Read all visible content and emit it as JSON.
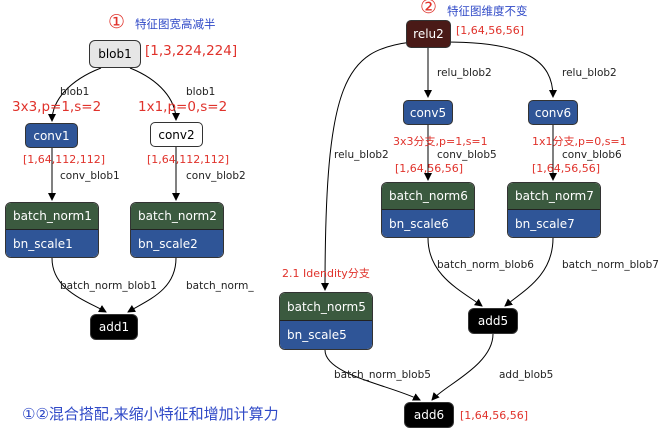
{
  "annotations": {
    "left_marker": "①",
    "left_title": "特征图宽高减半",
    "right_marker": "②",
    "right_title": "特征图维度不变",
    "identity_branch": "2.1 Idendity分支",
    "caption": "①②混合搭配,来缩小特征和增加计算力"
  },
  "nodes": {
    "blob1": "blob1",
    "conv1": "conv1",
    "conv2": "conv2",
    "batch_norm1": "batch_norm1",
    "bn_scale1": "bn_scale1",
    "batch_norm2": "batch_norm2",
    "bn_scale2": "bn_scale2",
    "add1": "add1",
    "relu2": "relu2",
    "conv5": "conv5",
    "conv6": "conv6",
    "batch_norm6": "batch_norm6",
    "bn_scale6": "bn_scale6",
    "batch_norm7": "batch_norm7",
    "bn_scale7": "bn_scale7",
    "batch_norm5": "batch_norm5",
    "bn_scale5": "bn_scale5",
    "add5": "add5",
    "add6": "add6"
  },
  "shapes": {
    "blob1": "[1,3,224,224]",
    "conv1": "[1,64,112,112]",
    "conv2": "[1,64,112,112]",
    "relu2": "[1,64,56,56]",
    "conv5": "[1,64,56,56]",
    "conv6": "[1,64,56,56]",
    "add6": "[1,64,56,56]"
  },
  "params": {
    "conv1": "3x3,p=1,s=2",
    "conv2": "1x1,p=0,s=2",
    "conv5": "3x3分支,p=1,s=1",
    "conv6": "1x1分支,p=0,s=1"
  },
  "edge_labels": {
    "blob1_conv1": "blob1",
    "blob1_conv2": "blob1",
    "conv1_out": "conv_blob1",
    "conv2_out": "conv_blob2",
    "bn1_out": "batch_norm_blob1",
    "bn2_out": "batch_norm_",
    "relu_conv5": "relu_blob2",
    "relu_conv6": "relu_blob2",
    "relu_bn5": "relu_blob2",
    "conv5_out": "conv_blob5",
    "conv6_out": "conv_blob6",
    "bn6_out": "batch_norm_blob6",
    "bn7_out": "batch_norm_blob7",
    "bn5_out": "batch_norm_blob5",
    "add5_out": "add_blob5"
  }
}
